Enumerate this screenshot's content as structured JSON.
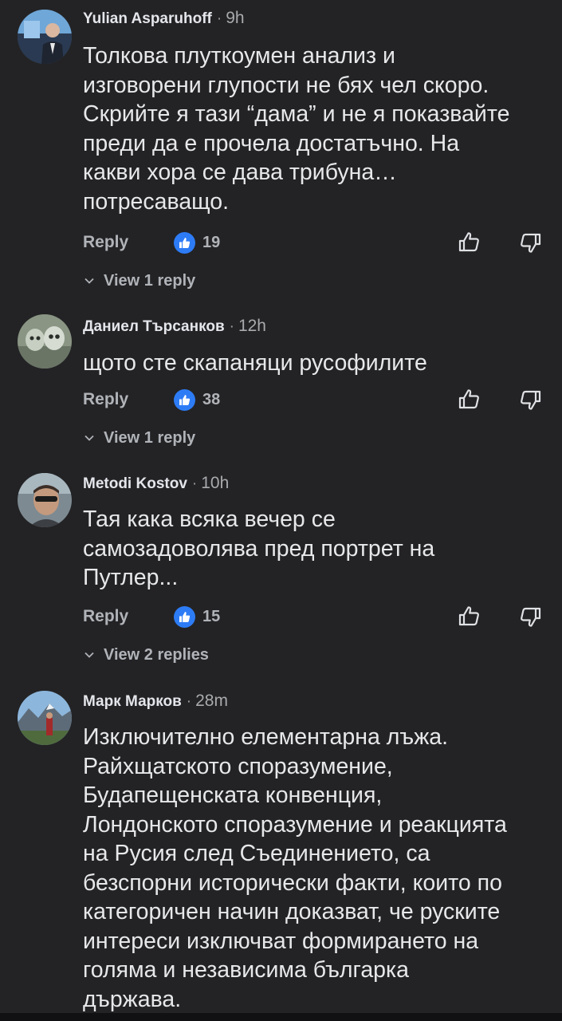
{
  "comments": [
    {
      "author": "Yulian Asparuhoff",
      "time": "9h",
      "text": "Толкова плуткоумен анализ и\nизговорени глупости не бях чел скоро.\nСкрийте я тази “дама” и не я показвайте\nпреди да е прочела достатъчно. На\nкакви хора се дава трибуна…\nпотресаващо.",
      "reply_label": "Reply",
      "likes": "19",
      "view_replies": "View 1 reply"
    },
    {
      "author": "Даниел Търсанков",
      "time": "12h",
      "text": "щото сте скапаняци русофилите",
      "reply_label": "Reply",
      "likes": "38",
      "view_replies": "View 1 reply"
    },
    {
      "author": "Metodi Kostov",
      "time": "10h",
      "text": "Тая кака всяка вечер се\nсамозадоволява пред портрет на\nПутлер...",
      "reply_label": "Reply",
      "likes": "15",
      "view_replies": "View 2 replies"
    },
    {
      "author": "Марк Марков",
      "time": "28m",
      "text": "Изключително елементарна лъжа.\nРайхщатското споразумение,\nБудапещенската конвенция,\nЛондонското споразумение и реакцията\nна Русия след Съединението, са\nбезспорни исторически факти, които по\nкатегоричен начин доказват, че руските\nинтереси изключват формирането на\nголяма и независима българка\nдържава."
    }
  ],
  "icons": {
    "like_badge": "thumbs-up-badge-icon",
    "like_button": "thumbs-up-outline-icon",
    "dislike_button": "thumbs-down-outline-icon",
    "expand": "chevron-down-icon"
  },
  "colors": {
    "background": "#232325",
    "like_blue": "#2d7cf6",
    "secondary_text": "#b0b3b8"
  }
}
